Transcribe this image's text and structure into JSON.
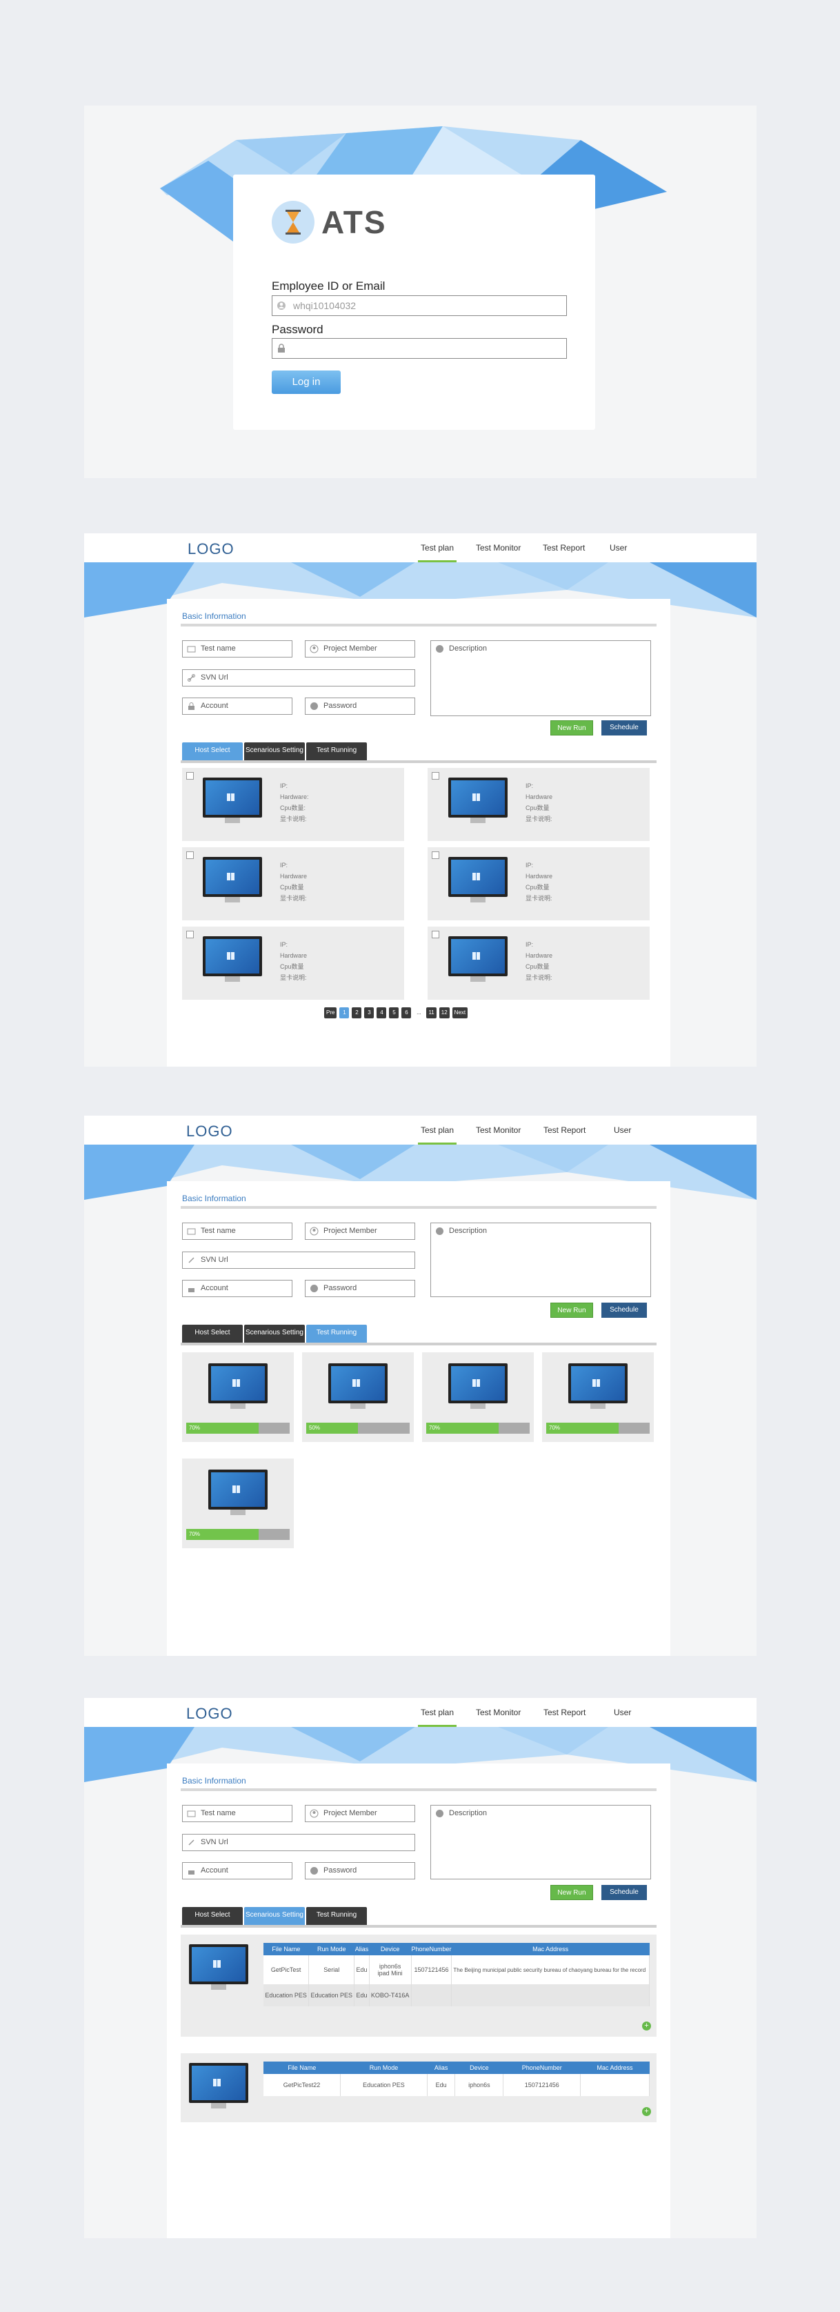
{
  "login": {
    "brand": "ATS",
    "employee_label": "Employee ID or Email",
    "employee_value": "whqi10104032",
    "password_label": "Password",
    "login_button": "Log in"
  },
  "app": {
    "logo": "LOGO",
    "nav": [
      "Test plan",
      "Test Monitor",
      "Test Report",
      "User"
    ],
    "section_title": "Basic Information",
    "fields": {
      "test_name": "Test name",
      "project_member": "Project Member",
      "svn_url": "SVN Url",
      "account": "Account",
      "password": "Password",
      "description": "Description"
    },
    "new_run": "New Run",
    "schedule": "Schedule",
    "tabs": [
      "Host Select",
      "Scenarious Setting",
      "Test Running"
    ]
  },
  "host_select": {
    "hosts": [
      {
        "ip": "IP:",
        "hardware": "Hardware:",
        "cpu": "Cpu数量:",
        "mem": "显卡说明:"
      },
      {
        "ip": "IP:",
        "hardware": "Hardware",
        "cpu": "Cpu数量",
        "mem": "显卡说明:"
      },
      {
        "ip": "IP:",
        "hardware": "Hardware",
        "cpu": "Cpu数量",
        "mem": "显卡说明:"
      },
      {
        "ip": "IP:",
        "hardware": "Hardware",
        "cpu": "Cpu数量",
        "mem": "显卡说明:"
      },
      {
        "ip": "IP:",
        "hardware": "Hardware",
        "cpu": "Cpu数量",
        "mem": "显卡说明:"
      },
      {
        "ip": "IP:",
        "hardware": "Hardware",
        "cpu": "Cpu数量",
        "mem": "显卡说明:"
      }
    ],
    "pager": [
      "Pre",
      "1",
      "2",
      "3",
      "4",
      "5",
      "6",
      "...",
      "11",
      "12",
      "Next"
    ]
  },
  "test_running": {
    "runs": [
      {
        "progress_label": "70%",
        "progress": 0.7
      },
      {
        "progress_label": "50%",
        "progress": 0.5
      },
      {
        "progress_label": "70%",
        "progress": 0.7
      },
      {
        "progress_label": "70%",
        "progress": 0.7
      },
      {
        "progress_label": "70%",
        "progress": 0.7
      }
    ]
  },
  "scenario_setting": {
    "columns": [
      "File Name",
      "Run Mode",
      "Alias",
      "Device",
      "PhoneNumber",
      "Mac Address"
    ],
    "cards": [
      {
        "rows": [
          [
            "GetPicTest",
            "Serial",
            "Edu",
            "iphon6s\nipad Mini",
            "1507121456",
            "The Beijing municipal public security bureau of chaoyang bureau for the record"
          ],
          [
            "Education PES",
            "Education PES",
            "Edu",
            "KOBO-T416A",
            "",
            ""
          ]
        ]
      },
      {
        "rows": [
          [
            "GetPicTest22",
            "Education PES",
            "Edu",
            "iphon6s",
            "1507121456",
            ""
          ]
        ]
      }
    ]
  },
  "colors": {
    "accent_blue": "#3d83c8",
    "green": "#66b94a",
    "dark_blue": "#2d5b8a",
    "tab_dark": "#3a3a3a"
  }
}
